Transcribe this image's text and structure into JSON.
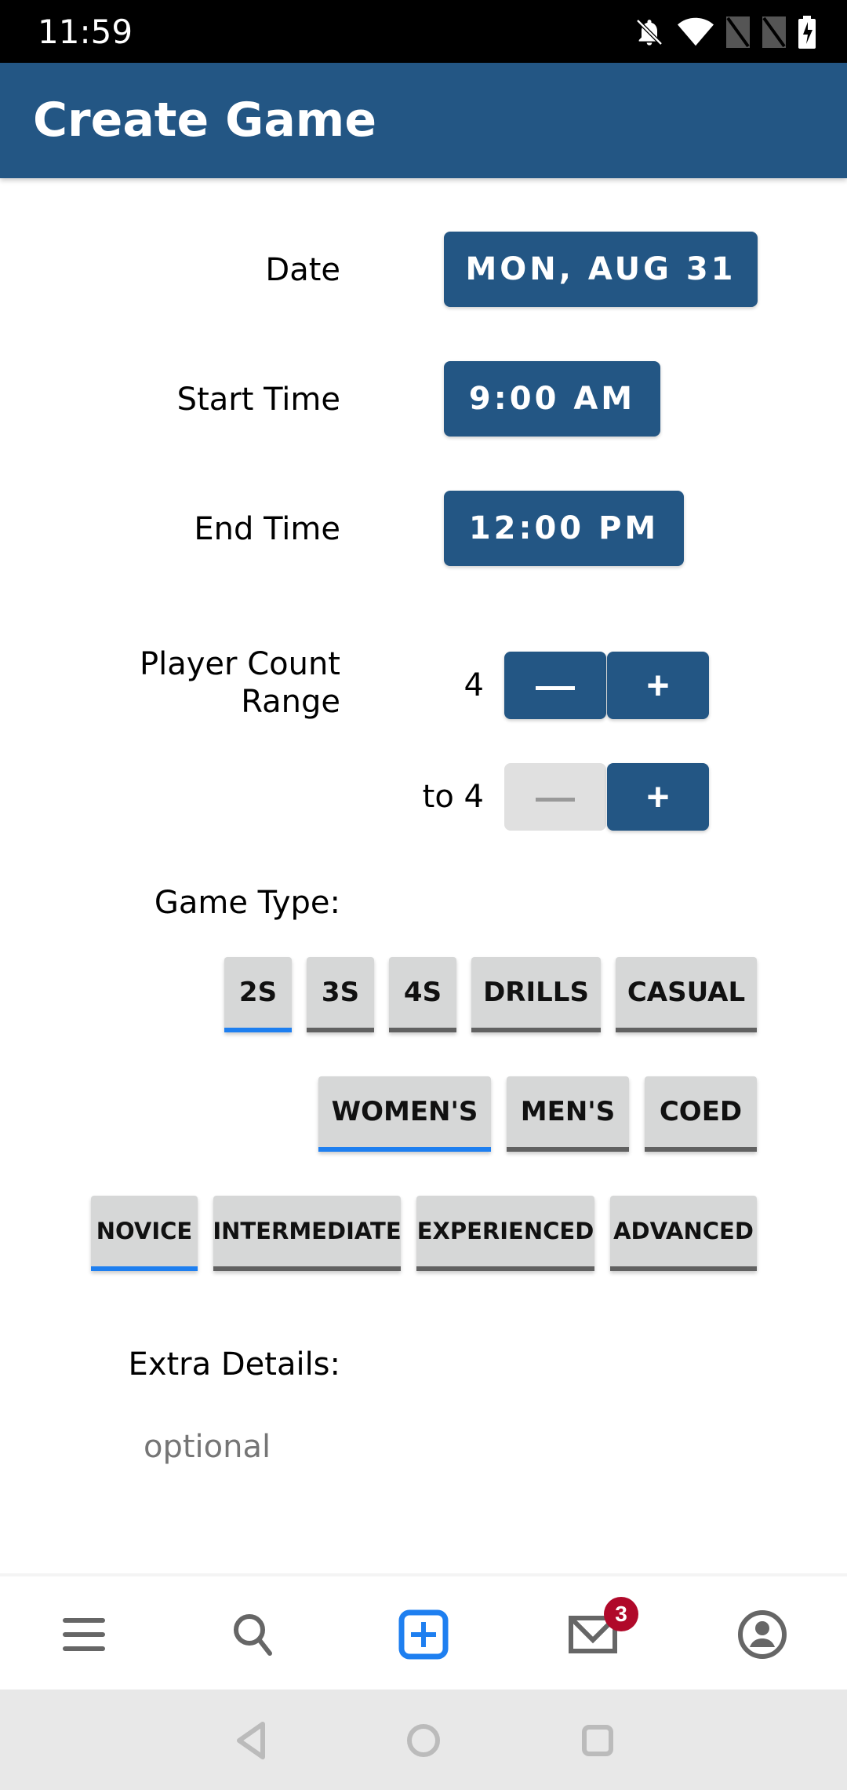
{
  "status_bar": {
    "time": "11:59",
    "icons": [
      "bell-off-icon",
      "wifi-icon",
      "no-signal-icon",
      "no-signal-icon",
      "battery-charging-icon"
    ]
  },
  "app_bar": {
    "title": "Create Game"
  },
  "form": {
    "date": {
      "label": "Date",
      "value": "MON, AUG 31"
    },
    "start_time": {
      "label": "Start Time",
      "value": "9:00 AM"
    },
    "end_time": {
      "label": "End Time",
      "value": "12:00 PM"
    },
    "player_count": {
      "label_line1": "Player Count",
      "label_line2": "Range",
      "min_value": "4",
      "max_value": "to 4",
      "decrement_symbol": "—",
      "increment_symbol": "+"
    },
    "game_type": {
      "label": "Game Type:",
      "formats": [
        {
          "label": "2S",
          "selected": true
        },
        {
          "label": "3S",
          "selected": false
        },
        {
          "label": "4S",
          "selected": false
        },
        {
          "label": "DRILLS",
          "selected": false
        },
        {
          "label": "CASUAL",
          "selected": false
        }
      ],
      "genders": [
        {
          "label": "WOMEN'S",
          "selected": true
        },
        {
          "label": "MEN'S",
          "selected": false
        },
        {
          "label": "COED",
          "selected": false
        }
      ],
      "levels": [
        {
          "label": "NOVICE",
          "selected": true
        },
        {
          "label": "INTERMEDIATE",
          "selected": false
        },
        {
          "label": "EXPERIENCED",
          "selected": false
        },
        {
          "label": "ADVANCED",
          "selected": false
        }
      ]
    },
    "extra_details": {
      "label": "Extra Details:",
      "placeholder": "optional",
      "value": ""
    }
  },
  "bottom_nav": {
    "items": [
      {
        "name": "menu",
        "icon": "menu-icon"
      },
      {
        "name": "search",
        "icon": "search-icon"
      },
      {
        "name": "create",
        "icon": "add-box-icon",
        "active": true
      },
      {
        "name": "messages",
        "icon": "mail-icon",
        "badge": "3"
      },
      {
        "name": "profile",
        "icon": "account-icon"
      }
    ]
  },
  "colors": {
    "primary": "#235684",
    "selected_underline": "#1e7ff0",
    "unselected_underline": "#616161",
    "badge": "#b0092a"
  }
}
